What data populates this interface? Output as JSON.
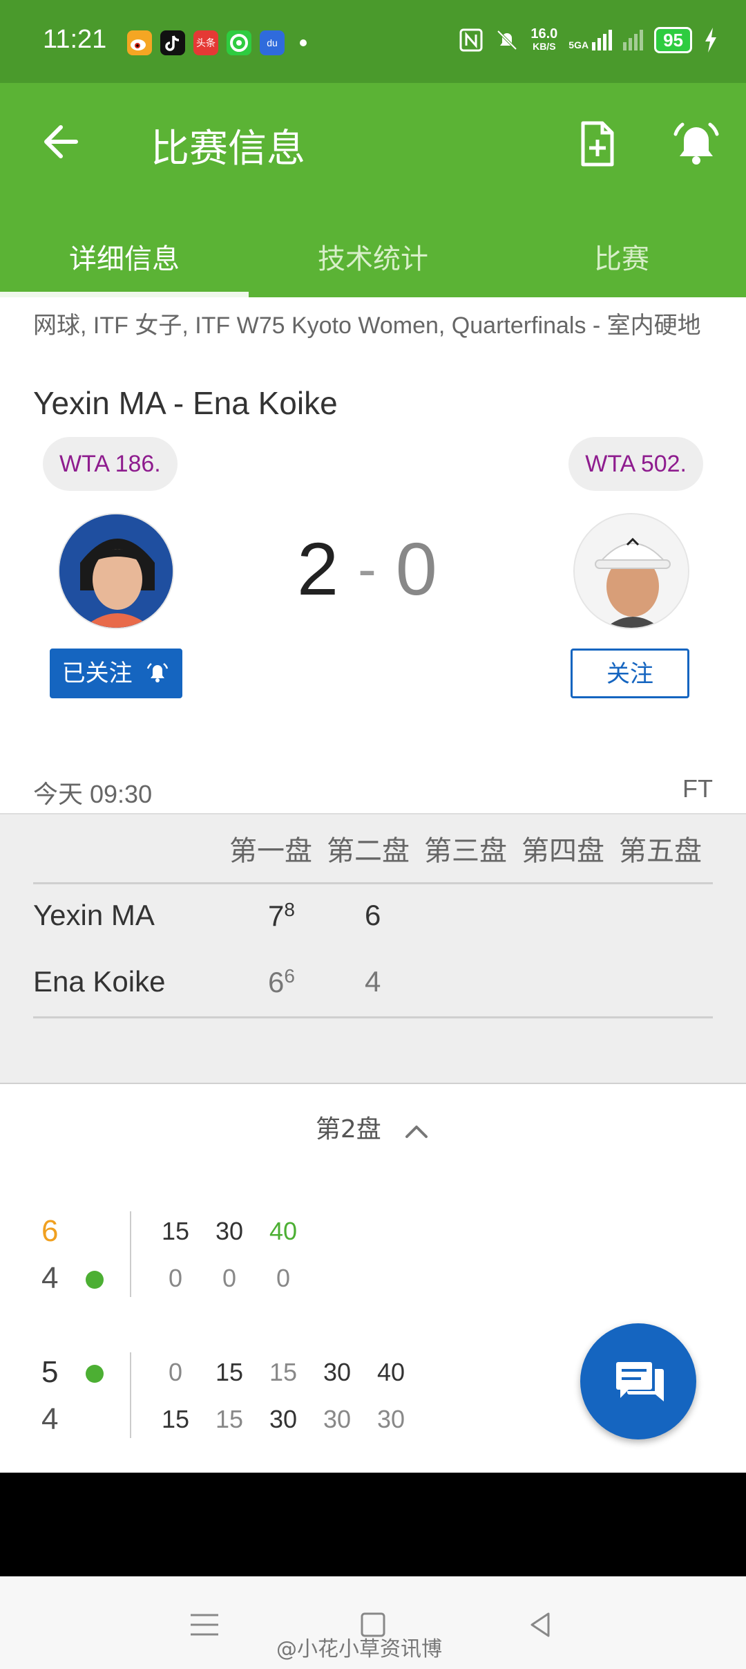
{
  "status_bar": {
    "time": "11:21",
    "apps": [
      "weibo-icon",
      "tiktok-icon",
      "toutiao-icon",
      "green-app-icon",
      "baidu-icon"
    ],
    "toutiao_label": "头条",
    "baidu_label": "du",
    "net_speed": "16.0",
    "net_unit": "KB/S",
    "network": "5GA",
    "battery": "95"
  },
  "app_bar": {
    "title": "比赛信息",
    "tabs": [
      {
        "label": "详细信息",
        "active": true
      },
      {
        "label": "技术统计",
        "active": false
      },
      {
        "label": "比赛",
        "active": false
      }
    ]
  },
  "match": {
    "meta": "网球, ITF 女子, ITF W75 Kyoto Women, Quarterfinals - 室内硬地",
    "title": "Yexin MA - Ena Koike",
    "home": {
      "name": "Yexin MA",
      "rank": "WTA 186.",
      "follow_label": "已关注"
    },
    "away": {
      "name": "Ena Koike",
      "rank": "WTA 502.",
      "follow_label": "关注"
    },
    "score_home": "2",
    "score_sep": "-",
    "score_away": "0",
    "date_time": "今天 09:30",
    "status": "FT"
  },
  "sets": {
    "headers": [
      "第一盘",
      "第二盘",
      "第三盘",
      "第四盘",
      "第五盘"
    ],
    "rows": [
      {
        "name": "Yexin MA",
        "s1": "7",
        "s1_tb": "8",
        "s2": "6"
      },
      {
        "name": "Ena Koike",
        "s1": "6",
        "s1_tb": "6",
        "s2": "4"
      }
    ]
  },
  "set_detail": {
    "toggle_label": "第2盘",
    "games": [
      {
        "top_score": "6",
        "bottom_score": "4",
        "top_points": [
          "15",
          "30",
          "40"
        ],
        "bottom_points": [
          "0",
          "0",
          "0"
        ]
      },
      {
        "top_score": "5",
        "bottom_score": "4",
        "top_points": [
          "0",
          "15",
          "15",
          "30",
          "40"
        ],
        "bottom_points": [
          "15",
          "15",
          "30",
          "30",
          "30"
        ]
      }
    ]
  },
  "watermark": "@小花小草资讯博",
  "colors": {
    "status_bar": "#4a9a2c",
    "app_bar": "#5bb335",
    "accent_blue": "#1565c0",
    "rank_text": "#8e1c8e",
    "serve_dot": "#4caf33",
    "game_score_orange": "#f0a020"
  }
}
